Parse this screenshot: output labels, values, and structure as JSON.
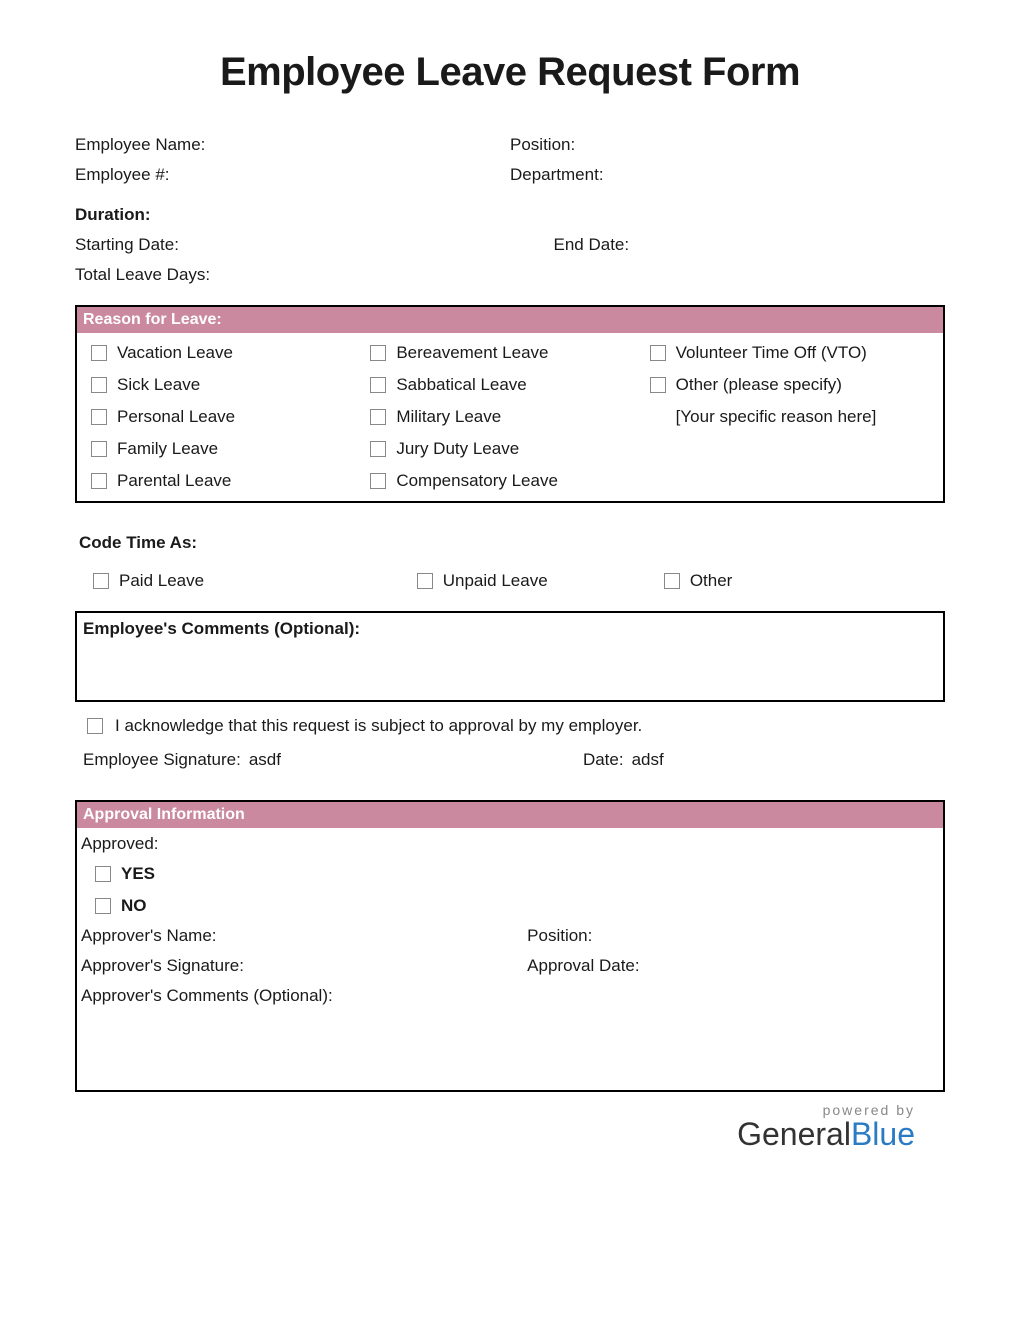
{
  "title": "Employee Leave Request Form",
  "fields": {
    "employee_name": "Employee Name:",
    "position": "Position:",
    "employee_num": "Employee #:",
    "department": "Department:",
    "duration": "Duration:",
    "starting_date": "Starting Date:",
    "end_date": "End Date:",
    "total_days": "Total Leave Days:"
  },
  "reason": {
    "header": "Reason for Leave:",
    "col1": [
      "Vacation Leave",
      "Sick Leave",
      "Personal Leave",
      "Family Leave",
      "Parental Leave"
    ],
    "col2": [
      "Bereavement Leave",
      "Sabbatical Leave",
      "Military Leave",
      "Jury Duty Leave",
      "Compensatory Leave"
    ],
    "col3": [
      "Volunteer Time Off (VTO)",
      "Other (please specify)"
    ],
    "other_placeholder": "[Your specific reason here]"
  },
  "code_time": {
    "header": "Code Time As:",
    "options": [
      "Paid Leave",
      "Unpaid Leave",
      "Other"
    ]
  },
  "comments": {
    "header": "Employee's Comments (Optional):"
  },
  "ack": "I acknowledge that this request is subject to approval by my employer.",
  "signature": {
    "label": "Employee Signature:",
    "value": "asdf",
    "date_label": "Date:",
    "date_value": "adsf"
  },
  "approval": {
    "header": "Approval Information",
    "approved_label": "Approved:",
    "yes": "YES",
    "no": "NO",
    "approver_name": "Approver's Name:",
    "position": "Position:",
    "approver_sig": "Approver's Signature:",
    "approval_date": "Approval Date:",
    "approver_comments": "Approver's Comments (Optional):"
  },
  "footer": {
    "powered": "powered by",
    "brand1": "General",
    "brand2": "Blue"
  }
}
